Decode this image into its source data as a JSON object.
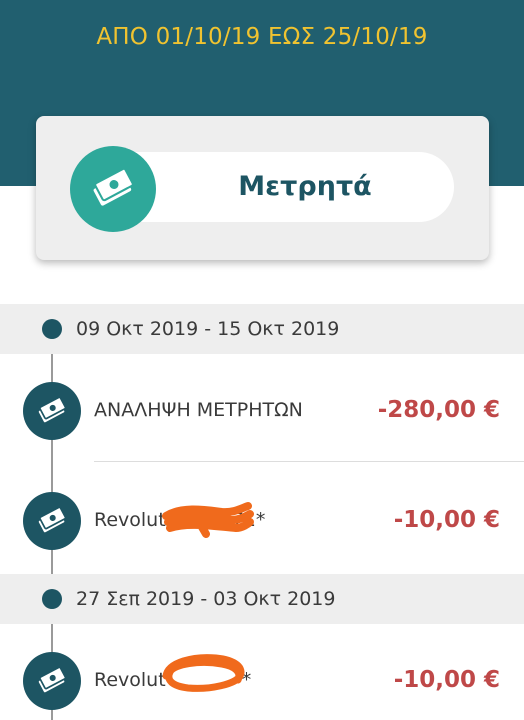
{
  "header": {
    "date_range": "ΑΠΟ 01/10/19 ΕΩΣ 25/10/19"
  },
  "account_card": {
    "icon": "cash-icon",
    "title": "Μετρητά"
  },
  "groups": [
    {
      "week": "09 Οκτ 2019 - 15 Οκτ 2019",
      "transactions": [
        {
          "icon": "cash-icon",
          "description": "ΑΝΑΛΗΨΗ ΜΕΤΡΗΤΩΝ",
          "amount": "-280,00 €"
        },
        {
          "icon": "cash-icon",
          "description": "Revolut",
          "description_tail": "71*",
          "amount": "-10,00 €"
        }
      ]
    },
    {
      "week": "27 Σεπ 2019 - 03 Οκτ 2019",
      "transactions": [
        {
          "icon": "cash-icon",
          "description": "Revolut",
          "description_tail": "*",
          "amount": "-10,00 €"
        }
      ]
    }
  ],
  "colors": {
    "header_bg": "#215f6f",
    "date_text": "#f0c330",
    "card_icon_bg": "#2ea89a",
    "txn_icon_bg": "#1d5563",
    "amount": "#bf4848",
    "redaction": "#f06a1c"
  }
}
